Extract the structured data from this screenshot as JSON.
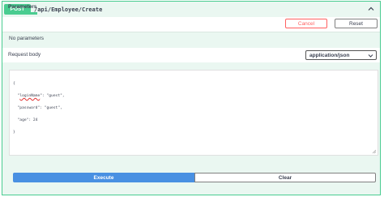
{
  "operation": {
    "method": "POST",
    "path": "/api/Employee/Create",
    "collapse_icon": "chevron-up-icon"
  },
  "parameters": {
    "tab_label": "Parameters",
    "cancel_label": "Cancel",
    "reset_label": "Reset",
    "empty_text": "No parameters"
  },
  "request_body": {
    "label": "Request body",
    "content_type": "application/json",
    "editor_lines": [
      "{",
      "  \"loginName\": \"guest\",",
      "  \"password\": \"guest\",",
      "  \"age\": 24",
      "}"
    ]
  },
  "actions": {
    "execute_label": "Execute",
    "clear_label": "Clear"
  },
  "colors": {
    "post_green": "#49cc90",
    "execute_blue": "#4990e2",
    "cancel_red": "#ff6060"
  }
}
